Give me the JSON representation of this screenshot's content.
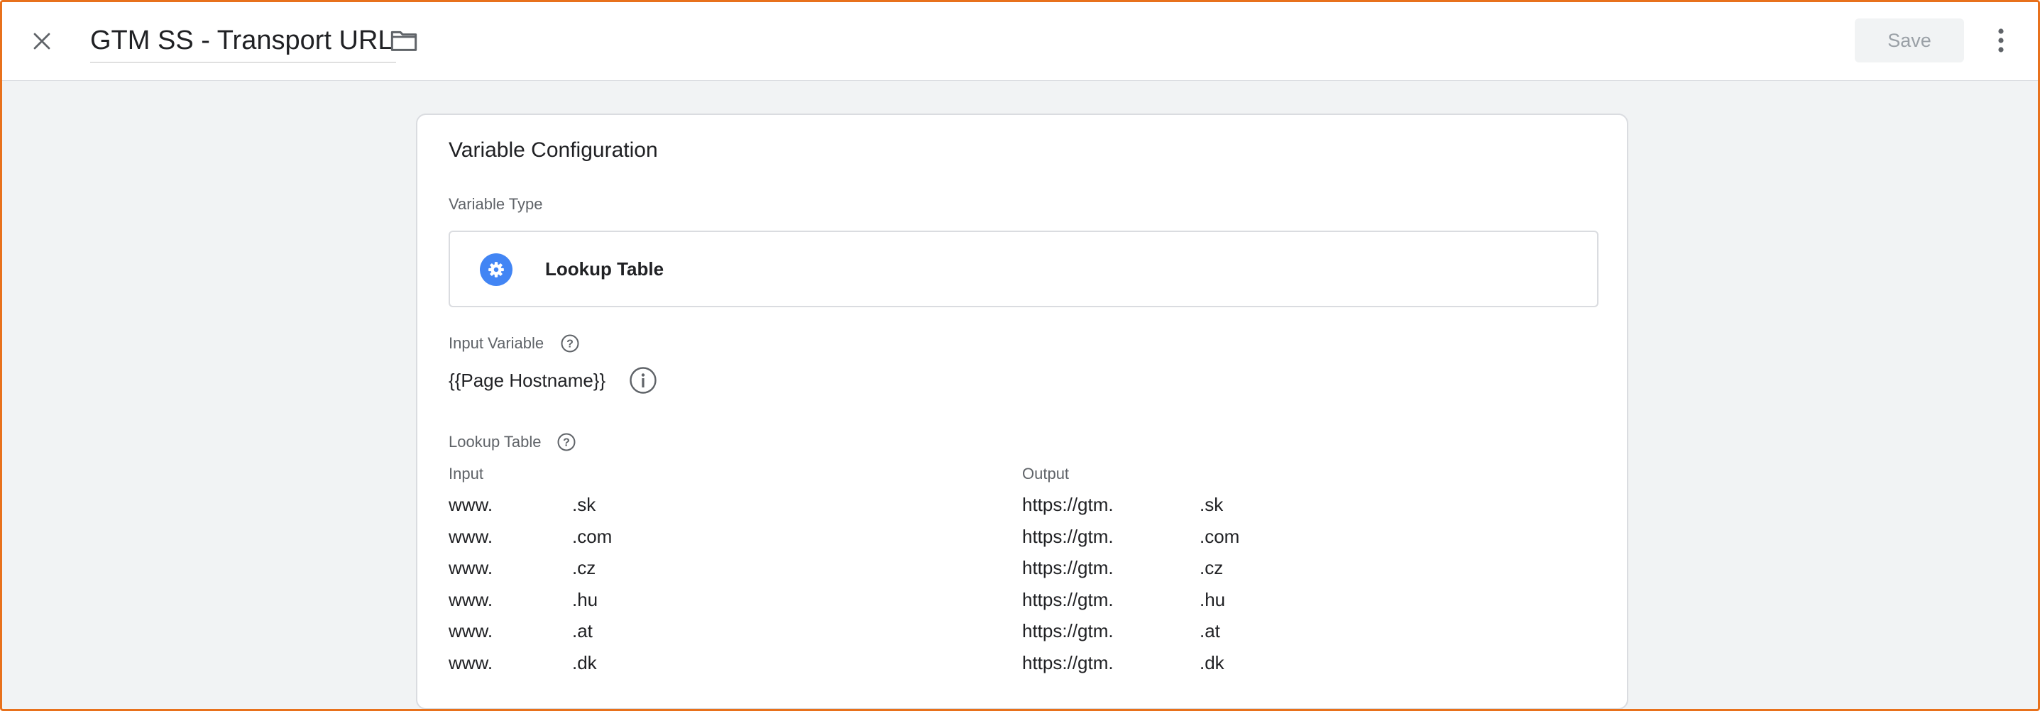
{
  "header": {
    "title": "GTM SS - Transport URL",
    "save_label": "Save",
    "icons": {
      "close": "close-icon",
      "folder": "folder-icon",
      "more": "more-vert-icon"
    }
  },
  "config": {
    "title": "Variable Configuration",
    "variable_type_label": "Variable Type",
    "variable_type": {
      "name": "Lookup Table",
      "icon": "gear-icon",
      "icon_color": "#4285f4"
    },
    "input_variable_label": "Input Variable",
    "input_variable_value": "{{Page Hostname}}",
    "lookup_table_label": "Lookup Table",
    "table": {
      "input_header": "Input",
      "output_header": "Output",
      "rows": [
        {
          "input_prefix": "www.",
          "input_suffix": ".sk",
          "output_prefix": "https://gtm.",
          "output_suffix": ".sk"
        },
        {
          "input_prefix": "www.",
          "input_suffix": ".com",
          "output_prefix": "https://gtm.",
          "output_suffix": ".com"
        },
        {
          "input_prefix": "www.",
          "input_suffix": ".cz",
          "output_prefix": "https://gtm.",
          "output_suffix": ".cz"
        },
        {
          "input_prefix": "www.",
          "input_suffix": ".hu",
          "output_prefix": "https://gtm.",
          "output_suffix": ".hu"
        },
        {
          "input_prefix": "www.",
          "input_suffix": ".at",
          "output_prefix": "https://gtm.",
          "output_suffix": ".at"
        },
        {
          "input_prefix": "www.",
          "input_suffix": ".dk",
          "output_prefix": "https://gtm.",
          "output_suffix": ".dk"
        }
      ]
    }
  },
  "colors": {
    "accent_border": "#e8711c",
    "background": "#f1f3f4",
    "brand_blue": "#4285f4"
  }
}
